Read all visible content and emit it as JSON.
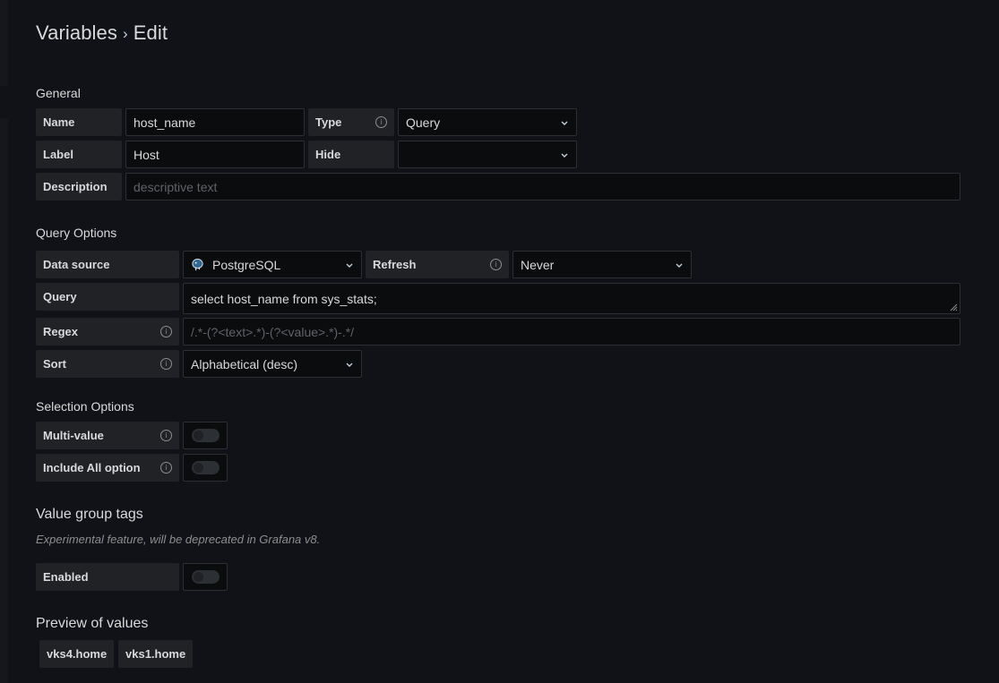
{
  "breadcrumb": {
    "section": "Variables",
    "separator": "›",
    "page": "Edit"
  },
  "general": {
    "title": "General",
    "name_label": "Name",
    "name_value": "host_name",
    "type_label": "Type",
    "type_value": "Query",
    "label_label": "Label",
    "label_value": "Host",
    "hide_label": "Hide",
    "hide_value": "",
    "description_label": "Description",
    "description_placeholder": "descriptive text"
  },
  "query_options": {
    "title": "Query Options",
    "datasource_label": "Data source",
    "datasource_value": "PostgreSQL",
    "datasource_icon": "postgresql-icon",
    "refresh_label": "Refresh",
    "refresh_value": "Never",
    "query_label": "Query",
    "query_value": "select host_name from sys_stats;",
    "regex_label": "Regex",
    "regex_placeholder": "/.*-(?<text>.*)-(?<value>.*)-.*/",
    "sort_label": "Sort",
    "sort_value": "Alphabetical (desc)"
  },
  "selection_options": {
    "title": "Selection Options",
    "multi_value_label": "Multi-value",
    "multi_value_enabled": false,
    "include_all_label": "Include All option",
    "include_all_enabled": false
  },
  "value_group_tags": {
    "title": "Value group tags",
    "description": "Experimental feature, will be deprecated in Grafana v8.",
    "enabled_label": "Enabled",
    "enabled": false
  },
  "preview": {
    "title": "Preview of values",
    "values": [
      "vks4.home",
      "vks1.home"
    ]
  },
  "colors": {
    "background": "#111217",
    "label_bg": "#202226",
    "input_bg": "#0b0c0e",
    "border": "#2c2f33"
  }
}
